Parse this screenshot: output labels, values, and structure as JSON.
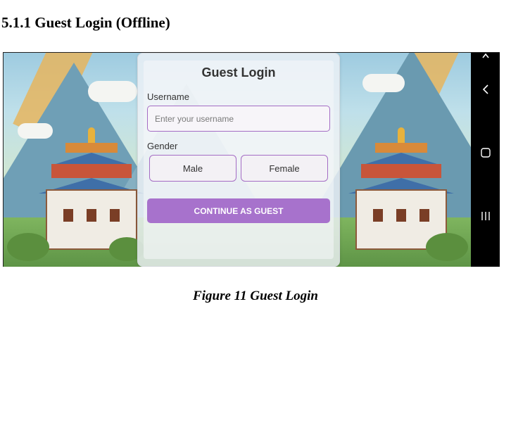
{
  "document": {
    "section_heading": "5.1.1 Guest Login (Offline)",
    "figure_caption": "Figure 11 Guest Login"
  },
  "app": {
    "title": "Guest Login",
    "username": {
      "label": "Username",
      "value": "",
      "placeholder": "Enter your username"
    },
    "gender": {
      "label": "Gender",
      "options": [
        "Male",
        "Female"
      ],
      "selected": null
    },
    "continue_button_label": "CONTINUE AS GUEST",
    "accent_color": "#a772cc",
    "background": "illustrated mountains with Bhutanese dzong temples"
  },
  "system_nav": {
    "icons": [
      "chevron-up-icon",
      "back-icon",
      "home-icon",
      "recents-icon"
    ]
  }
}
